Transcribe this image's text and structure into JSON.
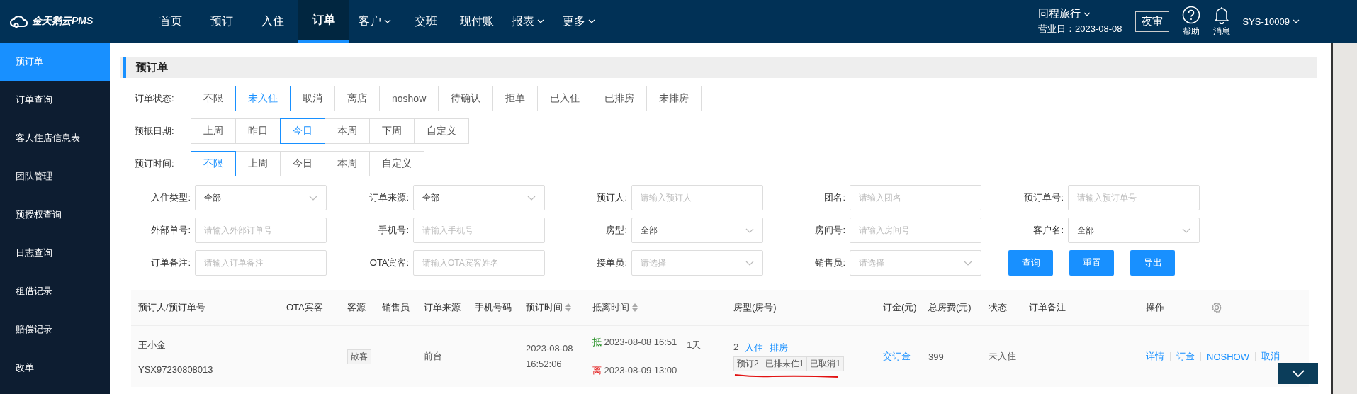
{
  "app": {
    "logo": "金天鹅云PMS"
  },
  "nav": [
    {
      "label": "首页",
      "selected": false,
      "dropdown": false
    },
    {
      "label": "预订",
      "selected": false,
      "dropdown": false
    },
    {
      "label": "入住",
      "selected": false,
      "dropdown": false
    },
    {
      "label": "订单",
      "selected": true,
      "dropdown": false
    },
    {
      "label": "客户",
      "selected": false,
      "dropdown": true
    },
    {
      "label": "交班",
      "selected": false,
      "dropdown": false
    },
    {
      "label": "现付账",
      "selected": false,
      "dropdown": false
    },
    {
      "label": "报表",
      "selected": false,
      "dropdown": true
    },
    {
      "label": "更多",
      "selected": false,
      "dropdown": true
    }
  ],
  "hotel": {
    "name": "同程旅行",
    "business_date": "营业日：2023-08-08"
  },
  "night_audit_button": "夜审",
  "help": "帮助",
  "messages": "消息",
  "user": "SYS-10009",
  "sidebar": [
    {
      "label": "预订单",
      "selected": true
    },
    {
      "label": "订单查询",
      "selected": false
    },
    {
      "label": "客人住店信息表",
      "selected": false
    },
    {
      "label": "团队管理",
      "selected": false
    },
    {
      "label": "预授权查询",
      "selected": false
    },
    {
      "label": "日志查询",
      "selected": false
    },
    {
      "label": "租借记录",
      "selected": false
    },
    {
      "label": "赔偿记录",
      "selected": false
    },
    {
      "label": "改单",
      "selected": false
    }
  ],
  "page_title": "预订单",
  "filter_groups": [
    {
      "label": "订单状态:",
      "options": [
        {
          "label": "不限",
          "selected": false
        },
        {
          "label": "未入住",
          "selected": true
        },
        {
          "label": "取消",
          "selected": false
        },
        {
          "label": "离店",
          "selected": false
        },
        {
          "label": "noshow",
          "selected": false
        },
        {
          "label": "待确认",
          "selected": false
        },
        {
          "label": "拒单",
          "selected": false
        },
        {
          "label": "已入住",
          "selected": false
        },
        {
          "label": "已排房",
          "selected": false
        },
        {
          "label": "未排房",
          "selected": false
        }
      ]
    },
    {
      "label": "预抵日期:",
      "options": [
        {
          "label": "上周",
          "selected": false
        },
        {
          "label": "昨日",
          "selected": false
        },
        {
          "label": "今日",
          "selected": true
        },
        {
          "label": "本周",
          "selected": false
        },
        {
          "label": "下周",
          "selected": false
        },
        {
          "label": "自定义",
          "selected": false
        }
      ]
    },
    {
      "label": "预订时间:",
      "options": [
        {
          "label": "不限",
          "selected": true
        },
        {
          "label": "上周",
          "selected": false
        },
        {
          "label": "今日",
          "selected": false
        },
        {
          "label": "本周",
          "selected": false
        },
        {
          "label": "自定义",
          "selected": false
        }
      ]
    }
  ],
  "fields": [
    {
      "label": "入住类型:",
      "kind": "select",
      "value": "全部"
    },
    {
      "label": "订单来源:",
      "kind": "select",
      "value": "全部"
    },
    {
      "label": "预订人:",
      "kind": "input",
      "placeholder": "请输入预订人"
    },
    {
      "label": "团名:",
      "kind": "input",
      "placeholder": "请输入团名"
    },
    {
      "label": "预订单号:",
      "kind": "input",
      "placeholder": "请输入预订单号"
    },
    {
      "label": "外部单号:",
      "kind": "input",
      "placeholder": "请输入外部订单号"
    },
    {
      "label": "手机号:",
      "kind": "input",
      "placeholder": "请输入手机号"
    },
    {
      "label": "房型:",
      "kind": "select",
      "value": "全部"
    },
    {
      "label": "房间号:",
      "kind": "input",
      "placeholder": "请输入房间号"
    },
    {
      "label": "客户名:",
      "kind": "select",
      "value": "全部"
    },
    {
      "label": "订单备注:",
      "kind": "input",
      "placeholder": "请输入订单备注"
    },
    {
      "label": "OTA宾客:",
      "kind": "input",
      "placeholder": "请输入OTA宾客姓名"
    },
    {
      "label": "接单员:",
      "kind": "select",
      "placeholder": "请选择"
    },
    {
      "label": "销售员:",
      "kind": "select",
      "placeholder": "请选择"
    }
  ],
  "actions": [
    "查询",
    "重置",
    "导出"
  ],
  "table": {
    "columns": [
      {
        "label": "预订人/预订单号",
        "sortable": false
      },
      {
        "label": "OTA宾客",
        "sortable": false
      },
      {
        "label": "客源",
        "sortable": false
      },
      {
        "label": "销售员",
        "sortable": false
      },
      {
        "label": "订单来源",
        "sortable": false
      },
      {
        "label": "手机号码",
        "sortable": false
      },
      {
        "label": "预订时间",
        "sortable": true
      },
      {
        "label": "抵离时间",
        "sortable": true
      },
      {
        "label": "房型(房号)",
        "sortable": false
      },
      {
        "label": "订金(元)",
        "sortable": false
      },
      {
        "label": "总房费(元)",
        "sortable": false
      },
      {
        "label": "状态",
        "sortable": false
      },
      {
        "label": "订单备注",
        "sortable": false
      },
      {
        "label": "操作",
        "sortable": false
      }
    ],
    "rows": [
      {
        "booker": "王小金",
        "order_no": "YSX97230808013",
        "source": "散客",
        "channel": "前台",
        "booked_at": "2023-08-08 16:52:06",
        "arrival_mark": "抵",
        "arrival": "2023-08-08 16:51",
        "departure_mark": "离",
        "departure": "2023-08-09 13:00",
        "nights": "1天",
        "room_count": "2",
        "room_links": [
          "入住",
          "排房"
        ],
        "room_tags": [
          "预订2",
          "已排未住1",
          "已取消1"
        ],
        "deposit_link": "交订金",
        "total": "399",
        "status": "未入住",
        "actions": [
          "详情",
          "订金",
          "NOSHOW",
          "取消"
        ]
      }
    ]
  }
}
